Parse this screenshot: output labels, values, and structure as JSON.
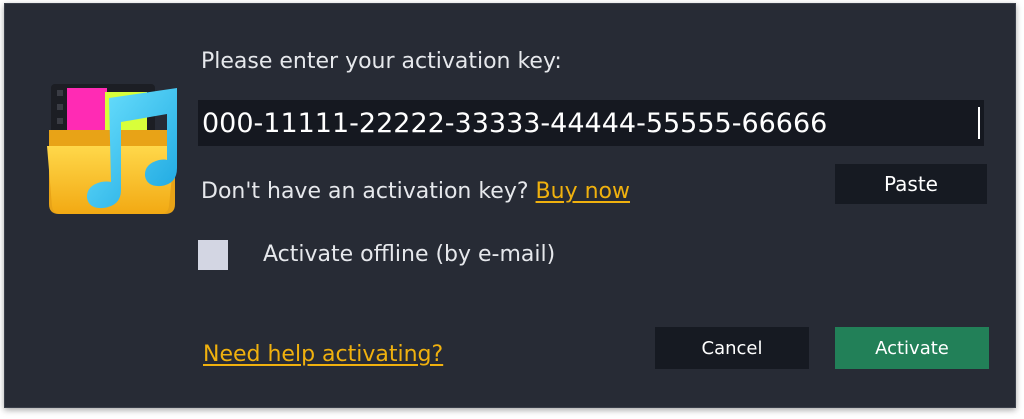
{
  "dialog": {
    "prompt": "Please enter your activation key:",
    "key_value": "000-11111-22222-33333-44444-55555-66666",
    "no_key_text": "Don't have an activation key?",
    "buy_now": "Buy now",
    "paste_label": "Paste",
    "offline_label": "Activate offline (by e-mail)",
    "offline_checked": false,
    "help_link": "Need help activating?",
    "cancel_label": "Cancel",
    "activate_label": "Activate"
  },
  "icons": {
    "app": "music-folder-icon"
  },
  "colors": {
    "background": "#272b35",
    "input_background": "#151820",
    "link": "#f0b10e",
    "primary_button": "#228058",
    "secondary_button": "#161a22"
  }
}
